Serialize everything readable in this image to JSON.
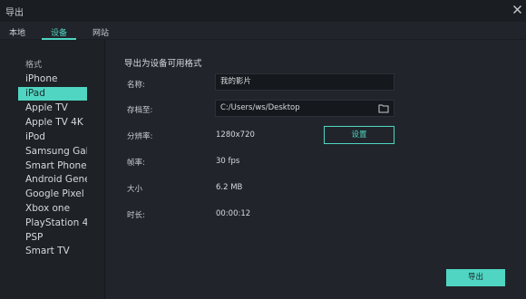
{
  "window": {
    "title": "导出"
  },
  "tabs": [
    {
      "label": "本地"
    },
    {
      "label": "设备"
    },
    {
      "label": "网站"
    }
  ],
  "sidebar": {
    "header": "格式",
    "items": [
      {
        "label": "iPhone"
      },
      {
        "label": "iPad"
      },
      {
        "label": "Apple TV"
      },
      {
        "label": "Apple TV 4K"
      },
      {
        "label": "iPod"
      },
      {
        "label": "Samsung Gala:"
      },
      {
        "label": "Smart Phone"
      },
      {
        "label": "Android Gene"
      },
      {
        "label": "Google Pixel"
      },
      {
        "label": "Xbox one"
      },
      {
        "label": "PlayStation 4"
      },
      {
        "label": "PSP"
      },
      {
        "label": "Smart TV"
      }
    ],
    "selected": "iPad"
  },
  "main": {
    "section_title": "导出为设备可用格式",
    "name": {
      "label": "名称:",
      "value": "我的影片"
    },
    "save_to": {
      "label": "存档至:",
      "value": "C:/Users/ws/Desktop"
    },
    "resolution": {
      "label": "分辨率:",
      "value": "1280x720"
    },
    "settings_button": "设置",
    "frame_rate": {
      "label": "帧率:",
      "value": "30 fps"
    },
    "size": {
      "label": "大小",
      "value": "6.2 MB"
    },
    "duration": {
      "label": "时长:",
      "value": "00:00:12"
    },
    "export_button": "导出"
  },
  "colors": {
    "accent": "#4fd5c2",
    "background": "#21252b",
    "sidebar": "#1e2126",
    "input": "#15181c"
  },
  "icons": {
    "close": "close-icon",
    "folder": "folder-icon"
  }
}
